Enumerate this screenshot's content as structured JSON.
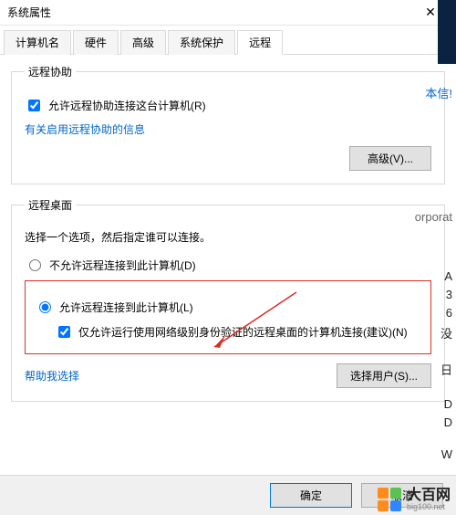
{
  "window": {
    "title": "系统属性"
  },
  "tabs": {
    "computer_name": "计算机名",
    "hardware": "硬件",
    "advanced": "高级",
    "protection": "系统保护",
    "remote": "远程"
  },
  "remote_assist": {
    "legend": "远程协助",
    "checkbox": "允许远程协助连接这台计算机(R)",
    "link": "有关启用远程协助的信息",
    "advanced_btn": "高级(V)..."
  },
  "remote_desktop": {
    "legend": "远程桌面",
    "desc": "选择一个选项，然后指定谁可以连接。",
    "opt_disallow": "不允许远程连接到此计算机(D)",
    "opt_allow": "允许远程连接到此计算机(L)",
    "nla_checkbox": "仅允许运行使用网络级别身份验证的远程桌面的计算机连接(建议)(N)",
    "help_link": "帮助我选择",
    "select_users_btn": "选择用户(S)..."
  },
  "dialog": {
    "ok": "确定",
    "cancel": "取消"
  },
  "peek": {
    "basic_info": "本信!",
    "corporat": "orporat",
    "a": "A",
    "three": "3",
    "six": "6",
    "wu": "没",
    "ri": "日",
    "d1": "D",
    "d2": "D",
    "w": "W"
  },
  "watermark": {
    "name": "大百网",
    "domain": "big100.net"
  }
}
